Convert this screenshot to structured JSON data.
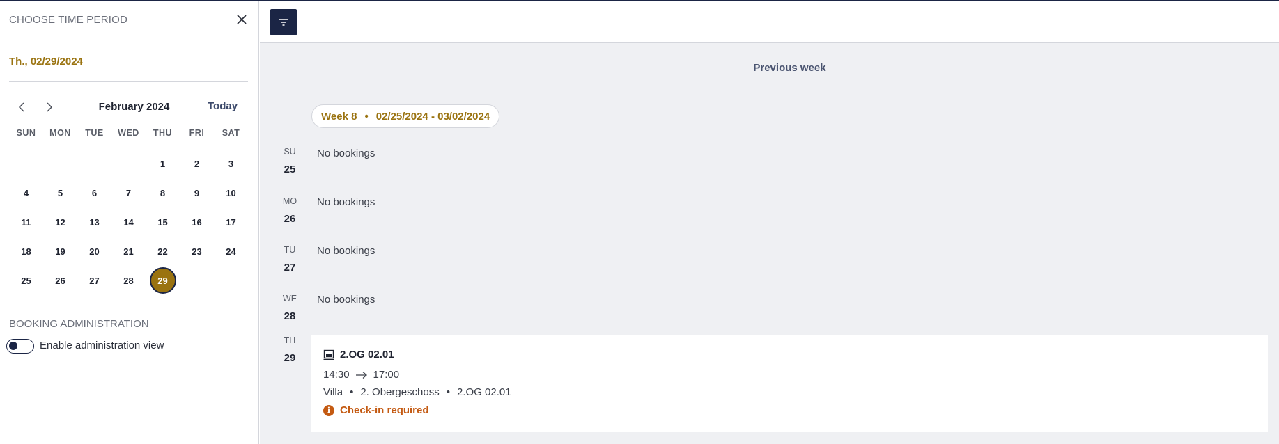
{
  "sidebar": {
    "title": "CHOOSE TIME PERIOD",
    "selected_date": "Th., 02/29/2024",
    "calendar": {
      "month_label": "February 2024",
      "today_label": "Today",
      "weekdays": [
        "SUN",
        "MON",
        "TUE",
        "WED",
        "THU",
        "FRI",
        "SAT"
      ],
      "weeks": [
        [
          "",
          "",
          "",
          "",
          "1",
          "2",
          "3"
        ],
        [
          "4",
          "5",
          "6",
          "7",
          "8",
          "9",
          "10"
        ],
        [
          "11",
          "12",
          "13",
          "14",
          "15",
          "16",
          "17"
        ],
        [
          "18",
          "19",
          "20",
          "21",
          "22",
          "23",
          "24"
        ],
        [
          "25",
          "26",
          "27",
          "28",
          "29",
          "",
          ""
        ]
      ],
      "selected_day": "29",
      "accent_color": "#9a7310"
    },
    "admin": {
      "title": "BOOKING ADMINISTRATION",
      "toggle_label": "Enable administration view"
    }
  },
  "main": {
    "previous_week_label": "Previous week",
    "week": {
      "label": "Week 8",
      "range": "02/25/2024 - 03/02/2024"
    },
    "days": [
      {
        "abbr": "SU",
        "num": "25",
        "text": "No bookings"
      },
      {
        "abbr": "MO",
        "num": "26",
        "text": "No bookings"
      },
      {
        "abbr": "TU",
        "num": "27",
        "text": "No bookings"
      },
      {
        "abbr": "WE",
        "num": "28",
        "text": "No bookings"
      },
      {
        "abbr": "TH",
        "num": "29",
        "text": ""
      }
    ],
    "booking": {
      "title": "2.OG 02.01",
      "start": "14:30",
      "end": "17:00",
      "location": [
        "Villa",
        "2. Obergeschoss",
        "2.OG 02.01"
      ],
      "status": "Check-in required",
      "status_color": "#c45a12"
    }
  }
}
